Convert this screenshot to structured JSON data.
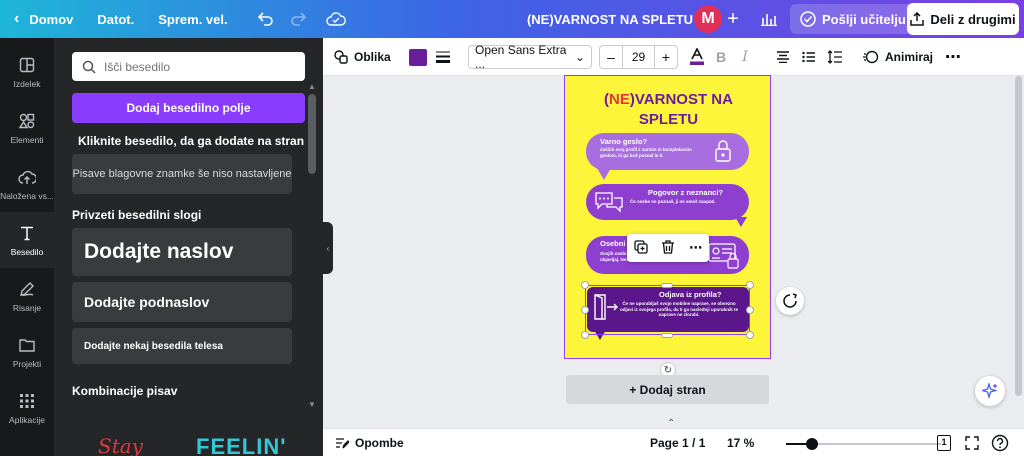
{
  "topbar": {
    "home": "Domov",
    "file": "Datot.",
    "resize": "Sprem. vel.",
    "doc_title": "(NE)VARNOST NA SPLETU",
    "avatar_letter": "M",
    "send_teacher": "Pošlji učitelju",
    "share": "Deli z drugimi"
  },
  "rail": {
    "items": [
      {
        "label": "Izdelek",
        "icon": "layout-icon"
      },
      {
        "label": "Elementi",
        "icon": "shapes-icon"
      },
      {
        "label": "Naložena vs...",
        "icon": "cloud-upload-icon"
      },
      {
        "label": "Besedilo",
        "icon": "text-icon",
        "active": true
      },
      {
        "label": "Risanje",
        "icon": "pen-icon"
      },
      {
        "label": "Projekti",
        "icon": "folder-icon"
      },
      {
        "label": "Aplikacije",
        "icon": "apps-icon"
      }
    ]
  },
  "panel": {
    "search_placeholder": "Išči besedilo",
    "add_textbox": "Dodaj besedilno polje",
    "hint": "Kliknite besedilo, da ga dodate na stran",
    "brand_fonts": "Pisave blagovne znamke še niso nastavljene",
    "default_styles_title": "Privzeti besedilni slogi",
    "heading": "Dodajte naslov",
    "subheading": "Dodajte podnaslov",
    "body": "Dodajte nekaj besedila telesa",
    "font_combos_title": "Kombinacije pisav",
    "sample1": "Stay",
    "sample2": "FEELIN'"
  },
  "toolbar": {
    "shape": "Oblika",
    "text_color": "#6a1e9b",
    "font": "Open Sans Extra ...",
    "size": "29",
    "animate": "Animiraj"
  },
  "poster": {
    "title_ne": "NE",
    "title_open": "(",
    "title_rest": ")VARNOST NA",
    "title_line2": "SPLETU",
    "bubble1_title": "Varno geslo?",
    "bubble1_text": "Zaščiti svoj profil z varnim in kompleksnim geslom, ki ga boš poznal le ti.",
    "bubble2_title": "Pogovor z neznanci?",
    "bubble2_text": "Če osebe ne poznaš, ji ne smeš zaupati.",
    "bubble3_title": "Osebni",
    "bubble3_text": "Svojih osebnih podatkov, kot je naslov, ... ne objavljaj. Neznanec jih lahko zlorabi.",
    "bubble4_title": "Odjava iz profila?",
    "bubble4_text": "Če ne uporabljaš svojo mobilne naprave, se obvezno odjavi iz svojega profila, da ti ga naslednji uporabnik te naprave ne zlorabi."
  },
  "canvas": {
    "add_page": "+ Dodaj stran"
  },
  "bottombar": {
    "notes": "Opombe",
    "page": "Page 1 / 1",
    "zoom": "17 %",
    "zoom_fraction": 0.17,
    "page_count": "1"
  },
  "colors": {
    "accent": "#8b3dff",
    "poster_bg": "#fcf53a",
    "poster_purple": "#6a1e9b",
    "poster_red": "#e4363e"
  }
}
